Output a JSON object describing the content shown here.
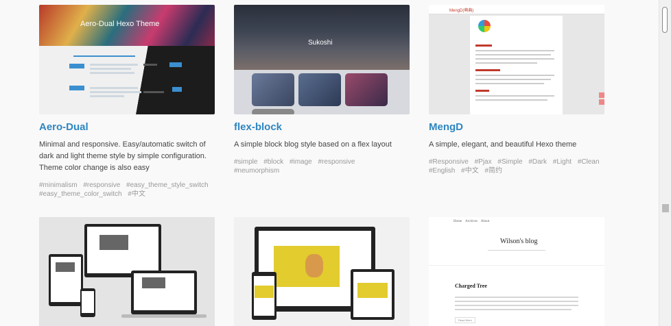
{
  "themes": [
    {
      "name": "Aero-Dual",
      "description": "Minimal and responsive. Easy/automatic switch of dark and light theme style by simple configuration. Theme color change is also easy",
      "tags": [
        "#minimalism",
        "#responsive",
        "#easy_theme_style_switch",
        "#easy_theme_color_switch",
        "#中文"
      ],
      "thumb_title": "Aero-Dual Hexo Theme"
    },
    {
      "name": "flex-block",
      "description": "A simple block blog style based on a flex layout",
      "tags": [
        "#simple",
        "#block",
        "#image",
        "#responsive",
        "#neumorphism"
      ],
      "thumb_title": "Sukoshi"
    },
    {
      "name": "MengD",
      "description": "A simple, elegant, and beautiful Hexo theme",
      "tags": [
        "#Responsive",
        "#Pjax",
        "#Simple",
        "#Dark",
        "#Light",
        "#Clean",
        "#English",
        "#中文",
        "#简约"
      ],
      "thumb_title": "MengD(萌典)"
    }
  ],
  "row2": {
    "blog_thumb": {
      "nav": [
        "Home",
        "Archives",
        "About"
      ],
      "title": "Wilson's blog",
      "post_title": "Charged Tree",
      "button": "Read More"
    }
  }
}
